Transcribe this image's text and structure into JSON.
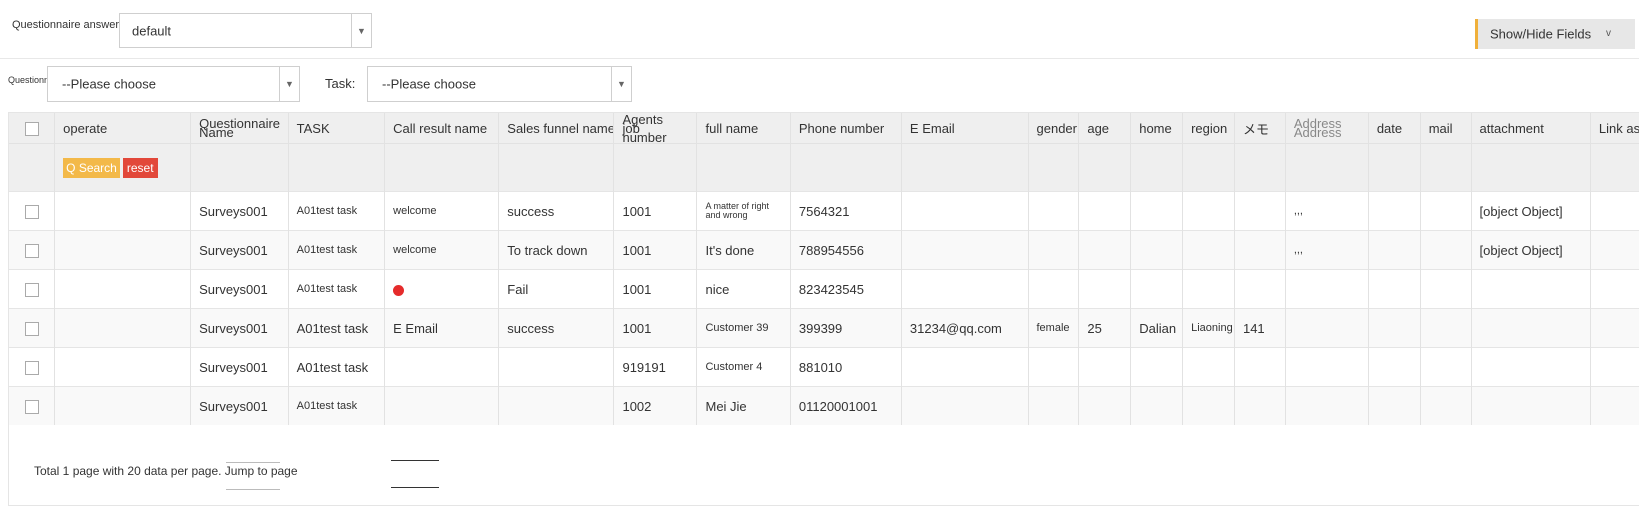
{
  "top": {
    "questionnaire_answers_label": "Questionnaire answers",
    "questionnaire_answers_value": "default",
    "show_hide_label": "Show/Hide Fields",
    "show_hide_chevron": "v"
  },
  "filters": {
    "questionnaire_label": "Questionnaire:",
    "questionnaire_value": "--Please choose",
    "task_label": "Task:",
    "task_value": "--Please choose"
  },
  "table": {
    "headers": {
      "operate": "operate",
      "questionnaire_name": "Questionnaire Name",
      "task": "TASK",
      "call_result": "Call result name",
      "sales_funnel": "Sales funnel name",
      "agents_job_number": "Agents job number",
      "full_name": "full name",
      "phone_number": "Phone number",
      "email": "E Email",
      "gender": "gender",
      "age": "age",
      "home": "home",
      "region": "region",
      "memo": "メモ",
      "address": "Address Address",
      "date": "date",
      "mail": "mail",
      "attachment": "attachment",
      "link_association": "Link association"
    },
    "search_label": "Q Search",
    "reset_label": "reset",
    "rows": [
      {
        "questionnaire_name": "Surveys001",
        "task": "A01test task",
        "call_result": "welcome",
        "sales_funnel": "success",
        "agents_job_number": "1001",
        "full_name": "A matter of right and wrong",
        "phone_number": "7564321",
        "email": "",
        "gender": "",
        "age": "",
        "home": "",
        "region": "",
        "memo": "",
        "address": ",,,",
        "date": "",
        "mail": "",
        "attachment": "[object Object]",
        "link_association": ""
      },
      {
        "questionnaire_name": "Surveys001",
        "task": "A01test task",
        "call_result": "welcome",
        "sales_funnel": "To track down",
        "agents_job_number": "1001",
        "full_name": "It's done",
        "phone_number": "788954556",
        "email": "",
        "gender": "",
        "age": "",
        "home": "",
        "region": "",
        "memo": "",
        "address": ",,,",
        "date": "",
        "mail": "",
        "attachment": "[object Object]",
        "link_association": ""
      },
      {
        "questionnaire_name": "Surveys001",
        "task": "A01test task",
        "call_result": "",
        "sales_funnel": "Fail",
        "agents_job_number": "1001",
        "full_name": "nice",
        "phone_number": "823423545",
        "email": "",
        "gender": "",
        "age": "",
        "home": "",
        "region": "",
        "memo": "",
        "address": "",
        "date": "",
        "mail": "",
        "attachment": "",
        "link_association": ""
      },
      {
        "questionnaire_name": "Surveys001",
        "task": "A01test task",
        "call_result": "E Email",
        "sales_funnel": "success",
        "agents_job_number": "1001",
        "full_name": "Customer 39",
        "phone_number": "399399",
        "email": "31234@qq.com",
        "gender": "female",
        "age": "25",
        "home": "Dalian",
        "region": "Liaoning",
        "memo": "141",
        "address": "",
        "date": "",
        "mail": "",
        "attachment": "",
        "link_association": ""
      },
      {
        "questionnaire_name": "Surveys001",
        "task": "A01test task",
        "call_result": "",
        "sales_funnel": "",
        "agents_job_number": "919191",
        "full_name": "Customer 4",
        "phone_number": "881010",
        "email": "",
        "gender": "",
        "age": "",
        "home": "",
        "region": "",
        "memo": "",
        "address": "",
        "date": "",
        "mail": "",
        "attachment": "",
        "link_association": ""
      },
      {
        "questionnaire_name": "Surveys001",
        "task": "A01test task",
        "call_result": "",
        "sales_funnel": "",
        "agents_job_number": "1002",
        "full_name": "Mei Jie",
        "phone_number": "01120001001",
        "email": "",
        "gender": "",
        "age": "",
        "home": "",
        "region": "",
        "memo": "",
        "address": "",
        "date": "",
        "mail": "",
        "attachment": "",
        "link_association": ""
      }
    ]
  },
  "pagination": {
    "summary": "Total 1 page with 20 data per page. Jump to page"
  },
  "colors": {
    "search": "#f3b949",
    "reset": "#e2483a",
    "show_hide_accent": "#f0b03a"
  }
}
